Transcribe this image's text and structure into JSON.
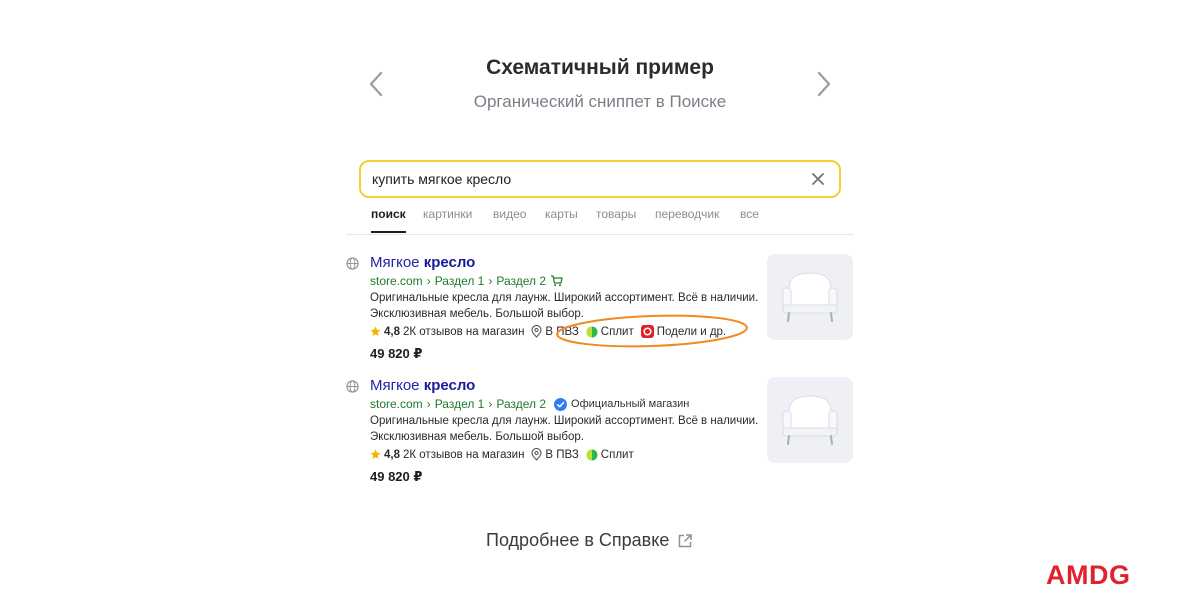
{
  "header": {
    "title": "Схематичный пример",
    "subtitle": "Органический сниппет в Поиске"
  },
  "search": {
    "value": "купить мягкое кресло"
  },
  "tabs": [
    {
      "label": "поиск",
      "active": true
    },
    {
      "label": "картинки"
    },
    {
      "label": "видео"
    },
    {
      "label": "карты"
    },
    {
      "label": "товары"
    },
    {
      "label": "переводчик"
    },
    {
      "label": "все"
    }
  ],
  "results": [
    {
      "title_plain": "Мягкое",
      "title_bold": "кресло",
      "url": {
        "domain": "store.com",
        "sep": "›",
        "section1": "Раздел 1",
        "section2": "Раздел 2"
      },
      "desc_line1": "Оригинальные кресла для лаунж. Широкий ассортимент. Всё в наличии.",
      "desc_line2": "Эксклюзивная мебель. Большой выбор.",
      "rating": "4,8",
      "reviews": "2К отзывов на магазин",
      "pickup": "В ПВЗ",
      "split": "Сплит",
      "pay": "Подели и др.",
      "price": "49 820 ₽"
    },
    {
      "title_plain": "Мягкое",
      "title_bold": "кресло",
      "url": {
        "domain": "store.com",
        "sep": "›",
        "section1": "Раздел 1",
        "section2": "Раздел 2"
      },
      "official": "Официальный магазин",
      "desc_line1": "Оригинальные кресла для лаунж. Широкий ассортимент. Всё в наличии.",
      "desc_line2": "Эксклюзивная мебель. Большой выбор.",
      "rating": "4,8",
      "reviews": "2К отзывов на магазин",
      "pickup": "В ПВЗ",
      "split": "Сплит",
      "price": "49 820 ₽"
    }
  ],
  "footer": {
    "more_link": "Подробнее в Справке",
    "logo": "AMDG"
  },
  "icons": {
    "prev": "chevron-left-icon",
    "next": "chevron-right-icon",
    "clear": "close-icon",
    "globe": "globe-icon",
    "cart": "cart-icon",
    "star": "star-icon",
    "location": "location-pin-icon",
    "split": "split-icon",
    "pay": "podeli-icon",
    "official": "verified-icon",
    "external": "external-link-icon"
  },
  "colors": {
    "search_border": "#f5cf33",
    "link": "#1f1fa8",
    "url_green": "#1f7a2b",
    "highlight_oval": "#f08a1f",
    "logo": "#e0222e"
  }
}
